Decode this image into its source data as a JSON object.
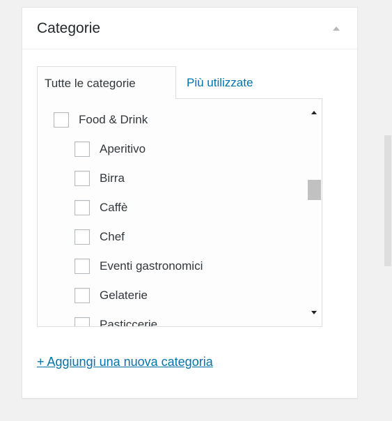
{
  "metabox": {
    "title": "Categorie",
    "toggle_icon": "arrow-up-icon"
  },
  "tabs": [
    {
      "label": "Tutte le categorie",
      "active": true
    },
    {
      "label": "Più utilizzate",
      "active": false
    }
  ],
  "categories": [
    {
      "label": "Food & Drink",
      "checked": false,
      "level": 0
    },
    {
      "label": "Aperitivo",
      "checked": false,
      "level": 1
    },
    {
      "label": "Birra",
      "checked": false,
      "level": 1
    },
    {
      "label": "Caffè",
      "checked": false,
      "level": 1
    },
    {
      "label": "Chef",
      "checked": false,
      "level": 1
    },
    {
      "label": "Eventi gastronomici",
      "checked": false,
      "level": 1
    },
    {
      "label": "Gelaterie",
      "checked": false,
      "level": 1
    },
    {
      "label": "Pasticcerie",
      "checked": false,
      "level": 1
    }
  ],
  "add_link": "+ Aggiungi una nuova categoria",
  "colors": {
    "link": "#0073aa",
    "border": "#dddddd",
    "background": "#f1f1f1"
  }
}
